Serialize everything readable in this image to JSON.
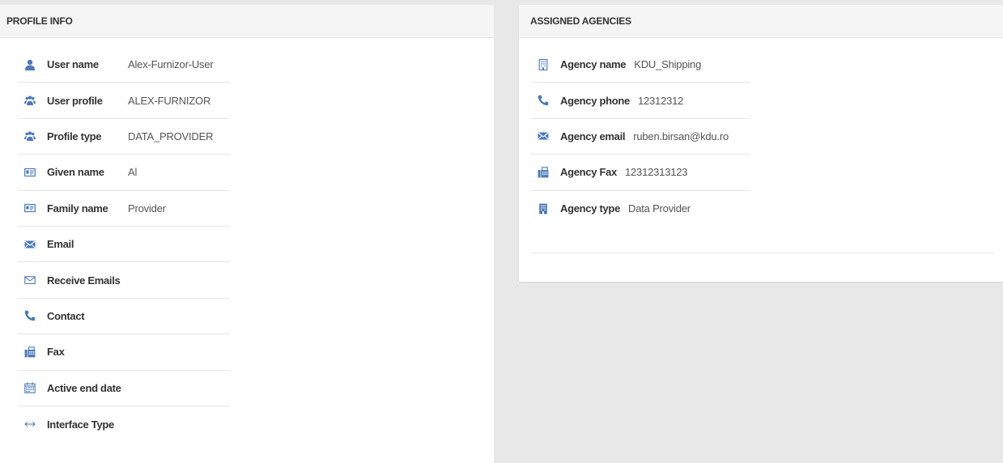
{
  "profile": {
    "title": "PROFILE INFO",
    "rows": [
      {
        "label": "User name",
        "value": "Alex-Furnizor-User",
        "icon": "user-icon"
      },
      {
        "label": "User profile",
        "value": "ALEX-FURNIZOR",
        "icon": "users-icon"
      },
      {
        "label": "Profile type",
        "value": "DATA_PROVIDER",
        "icon": "users-icon"
      },
      {
        "label": "Given name",
        "value": "Al",
        "icon": "id-card-icon"
      },
      {
        "label": "Family name",
        "value": "Provider",
        "icon": "id-card-icon"
      },
      {
        "label": "Email",
        "value": "",
        "icon": "envelope-icon"
      },
      {
        "label": "Receive Emails",
        "value": "",
        "icon": "envelope-outline-icon"
      },
      {
        "label": "Contact",
        "value": "",
        "icon": "phone-icon"
      },
      {
        "label": "Fax",
        "value": "",
        "icon": "fax-icon"
      },
      {
        "label": "Active end date",
        "value": "",
        "icon": "calendar-icon"
      },
      {
        "label": "Interface Type",
        "value": "",
        "icon": "arrows-horizontal-icon"
      }
    ]
  },
  "agencies": {
    "title": "ASSIGNED AGENCIES",
    "rows": [
      {
        "label": "Agency name",
        "value": "KDU_Shipping",
        "icon": "building-icon"
      },
      {
        "label": "Agency phone",
        "value": "12312312",
        "icon": "phone-icon"
      },
      {
        "label": "Agency email",
        "value": "ruben.birsan@kdu.ro",
        "icon": "envelope-icon"
      },
      {
        "label": "Agency Fax",
        "value": "12312313123",
        "icon": "fax-icon"
      },
      {
        "label": "Agency type",
        "value": "Data Provider",
        "icon": "building-icon"
      }
    ]
  },
  "colors": {
    "icon": "#4a7ab8",
    "header_bg": "#f5f5f5",
    "page_bg": "#e8e8e8"
  }
}
